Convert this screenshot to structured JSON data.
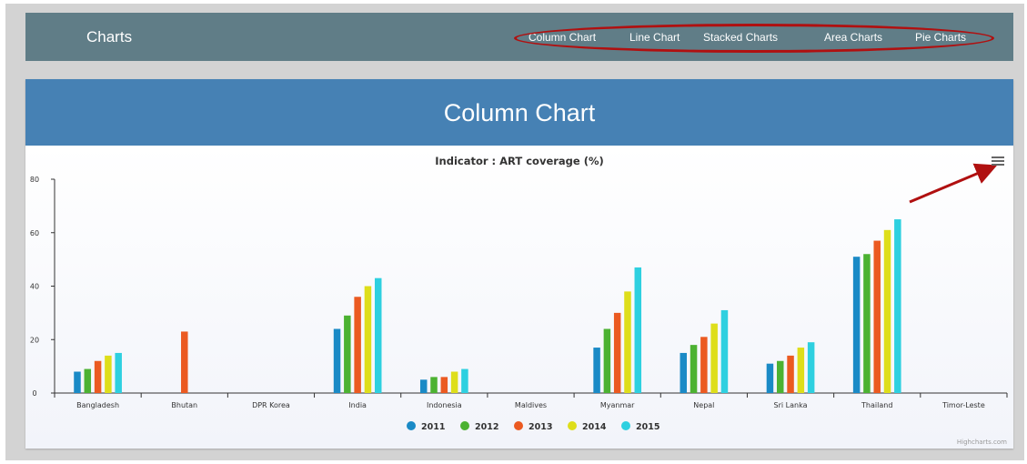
{
  "navbar": {
    "brand": "Charts",
    "items": [
      {
        "label": "Column Chart"
      },
      {
        "label": "Line Chart"
      },
      {
        "label": "Stacked Charts"
      },
      {
        "label": "Area Charts"
      },
      {
        "label": "Pie Charts"
      }
    ]
  },
  "panel": {
    "title": "Column Chart"
  },
  "credits": "Highcharts.com",
  "colors": {
    "navbar": "#607d87",
    "panel_header": "#4681b4",
    "annotation": "#b01010"
  },
  "chart_data": {
    "type": "bar",
    "title": "Indicator : ART coverage (%)",
    "xlabel": "",
    "ylabel": "",
    "ylim": [
      0,
      80
    ],
    "yticks": [
      0,
      20,
      40,
      60,
      80
    ],
    "grid": false,
    "legend_position": "bottom-center",
    "categories": [
      "Bangladesh",
      "Bhutan",
      "DPR Korea",
      "India",
      "Indonesia",
      "Maldives",
      "Myanmar",
      "Nepal",
      "Sri Lanka",
      "Thailand",
      "Timor-Leste"
    ],
    "series": [
      {
        "name": "2011",
        "color": "#1a8ac6",
        "values": [
          8,
          null,
          null,
          24,
          5,
          null,
          17,
          15,
          11,
          51,
          null
        ]
      },
      {
        "name": "2012",
        "color": "#4cb232",
        "values": [
          9,
          null,
          null,
          29,
          6,
          null,
          24,
          18,
          12,
          52,
          null
        ]
      },
      {
        "name": "2013",
        "color": "#eb5a21",
        "values": [
          12,
          23,
          null,
          36,
          6,
          null,
          30,
          21,
          14,
          57,
          null
        ]
      },
      {
        "name": "2014",
        "color": "#dede1a",
        "values": [
          14,
          null,
          null,
          40,
          8,
          null,
          38,
          26,
          17,
          61,
          null
        ]
      },
      {
        "name": "2015",
        "color": "#2ed0e0",
        "values": [
          15,
          null,
          null,
          43,
          9,
          null,
          47,
          31,
          19,
          65,
          null
        ]
      }
    ]
  }
}
